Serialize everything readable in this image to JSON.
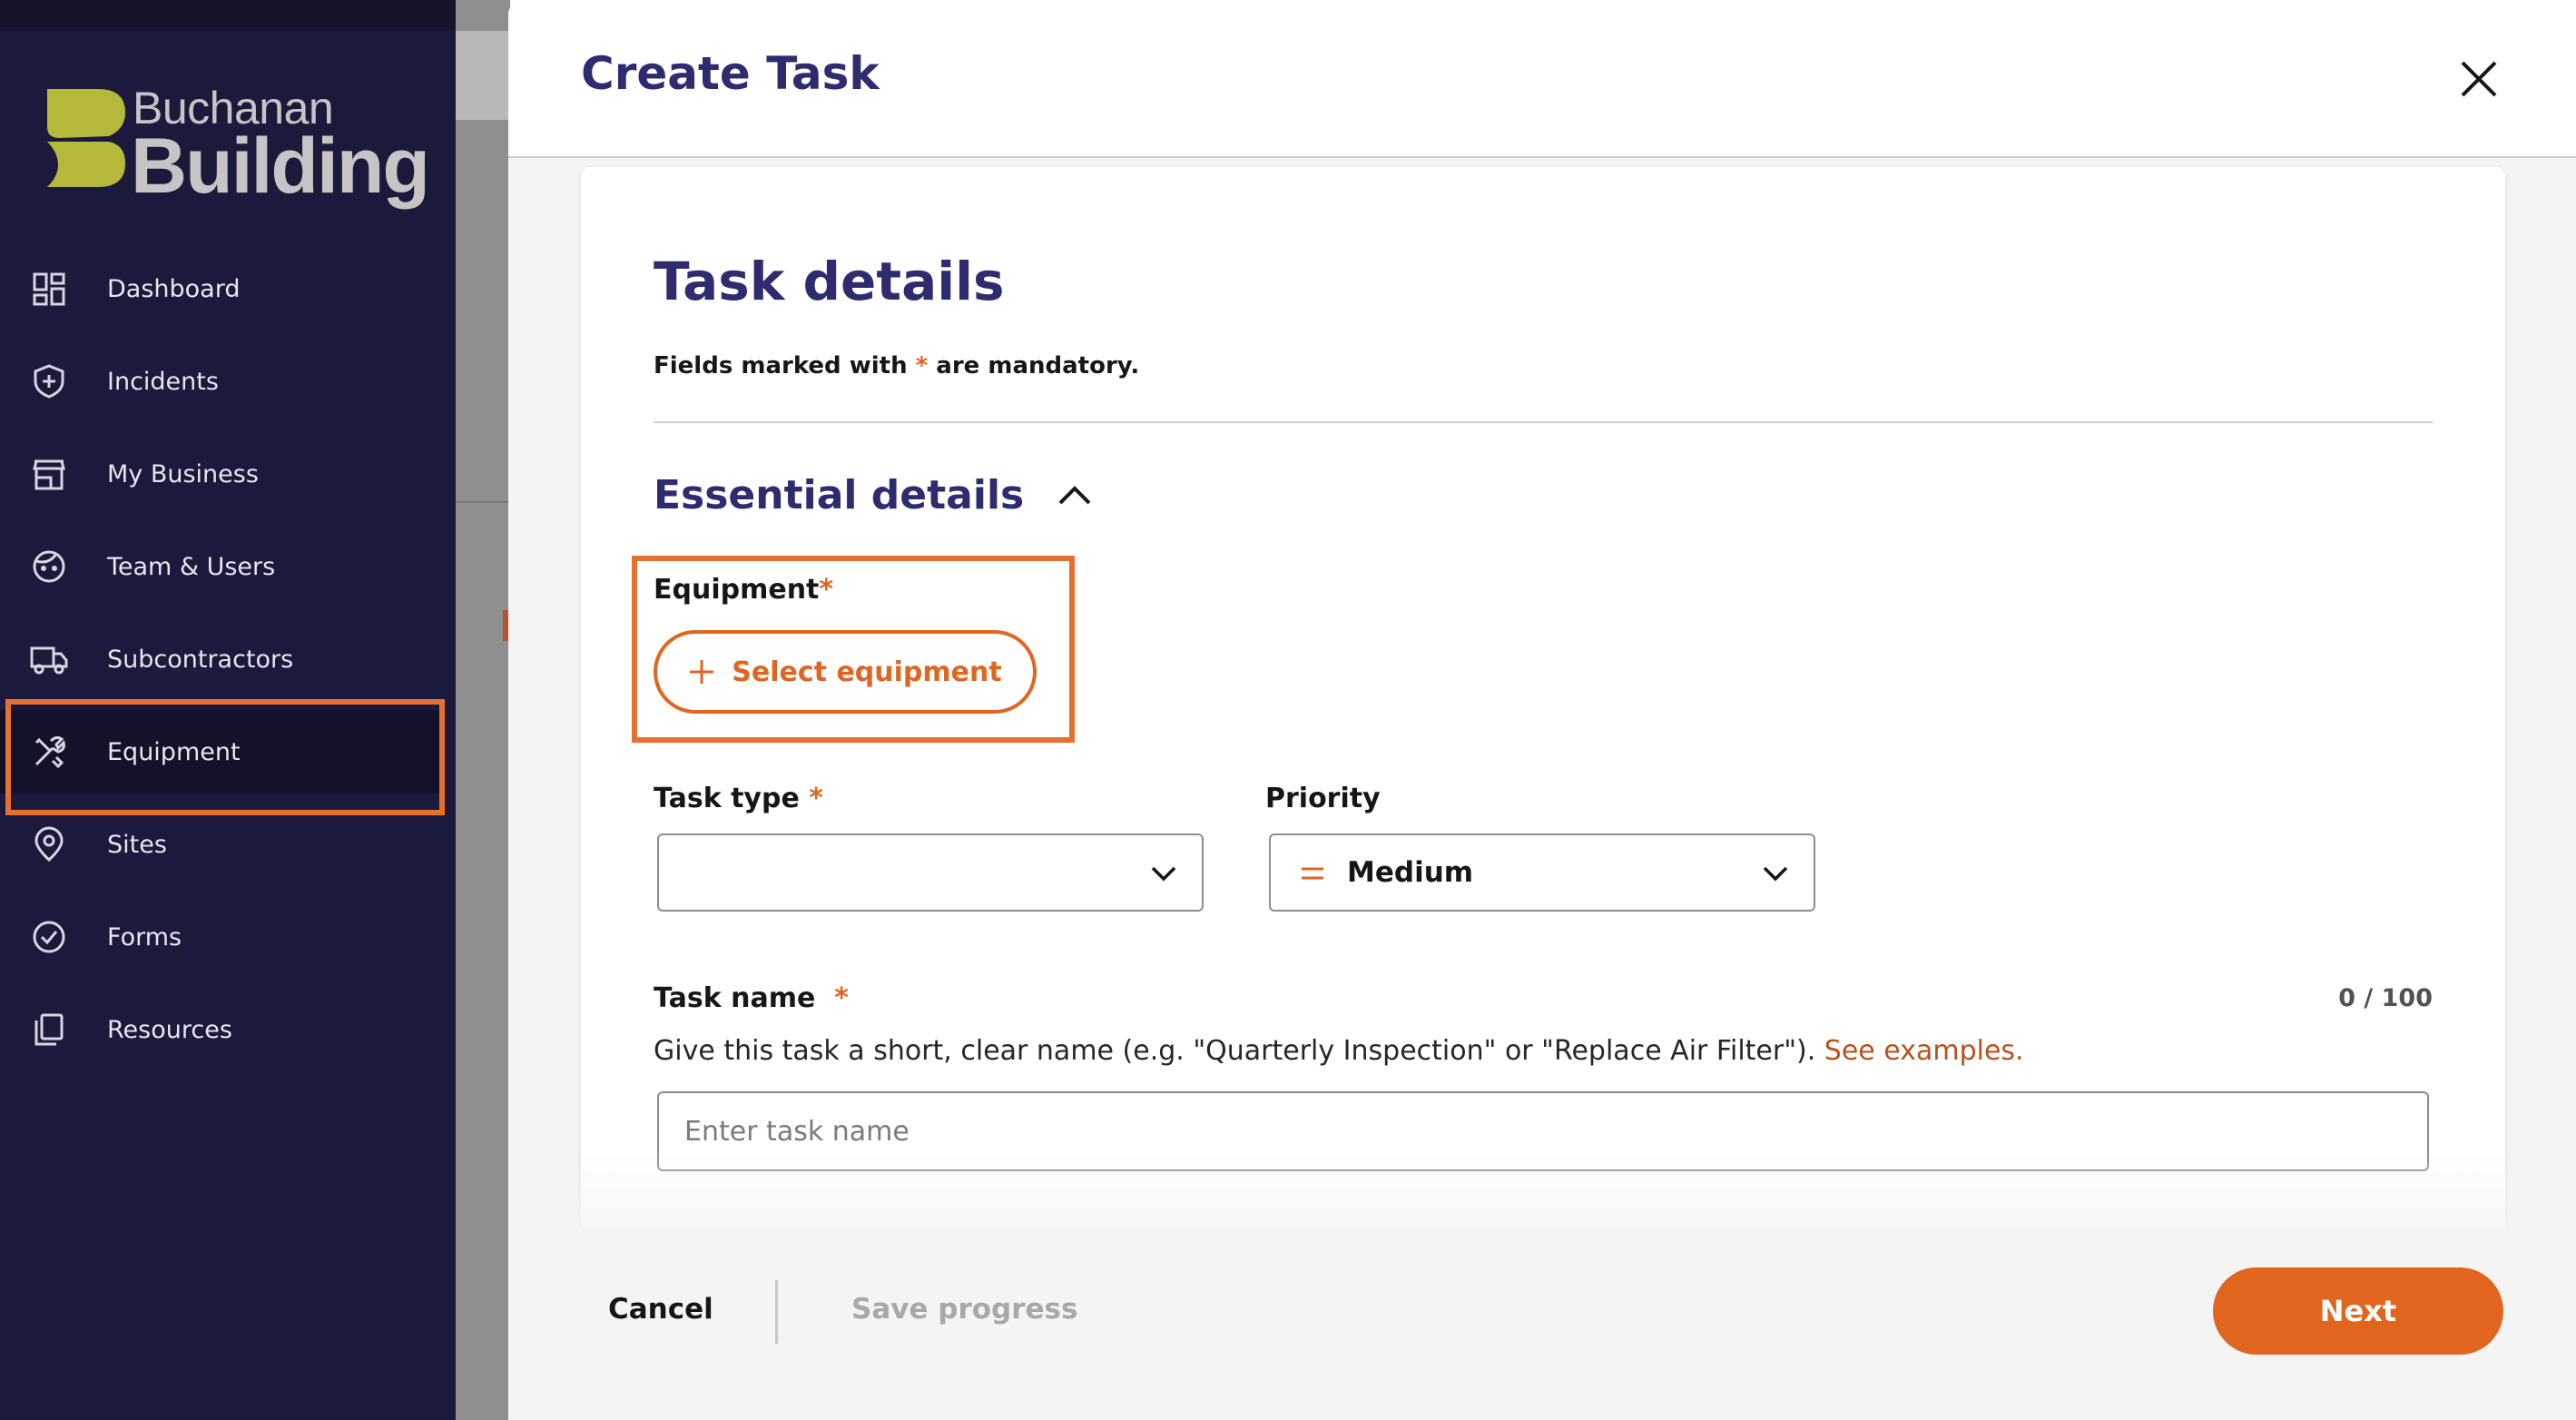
{
  "brand": {
    "name_top": "Buchanan",
    "name_bottom": "Building",
    "accent": "#e0651f",
    "logo_color": "#b5b83a"
  },
  "sidebar": {
    "items": [
      {
        "label": "Dashboard",
        "icon": "dashboard-icon"
      },
      {
        "label": "Incidents",
        "icon": "shield-plus-icon"
      },
      {
        "label": "My Business",
        "icon": "store-icon"
      },
      {
        "label": "Team & Users",
        "icon": "face-icon"
      },
      {
        "label": "Subcontractors",
        "icon": "truck-icon"
      },
      {
        "label": "Equipment",
        "icon": "tools-icon",
        "active": true
      },
      {
        "label": "Sites",
        "icon": "location-pin-icon"
      },
      {
        "label": "Forms",
        "icon": "check-circle-icon"
      },
      {
        "label": "Resources",
        "icon": "copy-icon"
      }
    ]
  },
  "modal": {
    "title": "Create Task",
    "section_title": "Task details",
    "mandatory_prefix": "Fields marked with ",
    "mandatory_star": "*",
    "mandatory_suffix": " are mandatory.",
    "subsection": "Essential details",
    "equipment": {
      "label": "Equipment",
      "required": "*",
      "button": "Select equipment"
    },
    "task_type": {
      "label": "Task type",
      "required": "*",
      "value": ""
    },
    "priority": {
      "label": "Priority",
      "value": "Medium"
    },
    "task_name": {
      "label": "Task name",
      "required": "*",
      "counter": "0 / 100",
      "helper": "Give this task a short, clear name (e.g. \"Quarterly Inspection\" or \"Replace Air Filter\"). ",
      "helper_link": "See examples.",
      "placeholder": "Enter task name",
      "value": ""
    }
  },
  "footer": {
    "cancel": "Cancel",
    "save": "Save progress",
    "next": "Next"
  }
}
